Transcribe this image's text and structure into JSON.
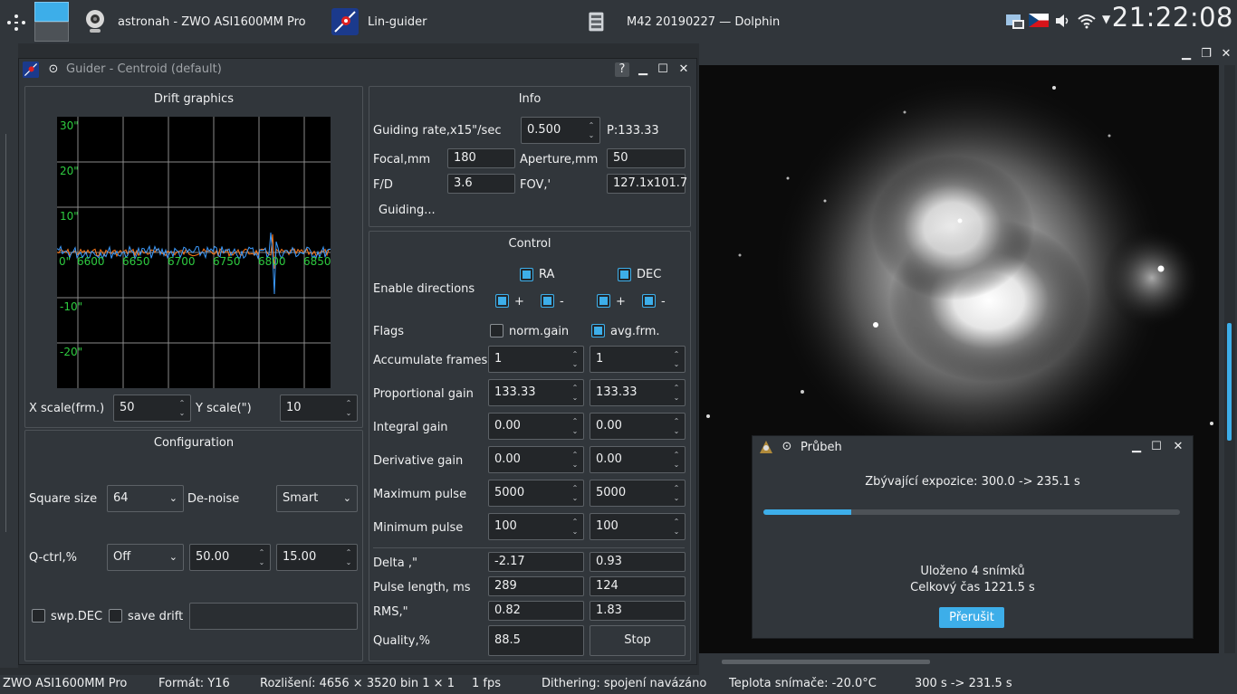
{
  "taskbar": {
    "tasks": [
      {
        "label": "astronah - ZWO ASI1600MM Pro",
        "icon": "webcam-icon"
      },
      {
        "label": "Lin-guider",
        "icon": "lin-guider-icon"
      },
      {
        "label": "M42 20190227 — Dolphin",
        "icon": "dolphin-icon"
      }
    ],
    "clock": "21:22:08"
  },
  "guider": {
    "title": "Guider - Centroid (default)",
    "drift": {
      "title": "Drift graphics",
      "y_labels": [
        "30\"",
        "20\"",
        "10\"",
        "-10\"",
        "-20\""
      ],
      "x_labels": [
        "0\"",
        "6600",
        "6650",
        "6700",
        "6750",
        "6800",
        "6850"
      ],
      "x_scale_label": "X scale(frm.)",
      "x_scale_value": "50",
      "y_scale_label": "Y scale(\")",
      "y_scale_value": "10"
    },
    "info": {
      "title": "Info",
      "guiding_rate_label": "Guiding rate,x15\"/sec",
      "guiding_rate_value": "0.500",
      "p_value": "P:133.33",
      "focal_label": "Focal,mm",
      "focal_value": "180",
      "aperture_label": "Aperture,mm",
      "aperture_value": "50",
      "fd_label": "F/D",
      "fd_value": "3.6",
      "fov_label": "FOV,'",
      "fov_value": "127.1x101.7",
      "status": "Guiding..."
    },
    "config": {
      "title": "Configuration",
      "square_size_label": "Square size",
      "square_size_value": "64",
      "denoise_label": "De-noise",
      "denoise_value": "Smart",
      "qctrl_label": "Q-ctrl,%",
      "qctrl_value": "Off",
      "qctrl_v1": "50.00",
      "qctrl_v2": "15.00",
      "swp_dec_label": "swp.DEC",
      "save_drift_label": "save drift",
      "save_drift_path": ""
    },
    "control": {
      "title": "Control",
      "enable_directions_label": "Enable directions",
      "ra_label": "RA",
      "dec_label": "DEC",
      "plus": "+",
      "minus": "-",
      "flags_label": "Flags",
      "norm_gain_label": "norm.gain",
      "avg_frm_label": "avg.frm.",
      "rows": [
        {
          "label": "Accumulate frames",
          "ra": "1",
          "dec": "1"
        },
        {
          "label": "Proportional gain",
          "ra": "133.33",
          "dec": "133.33"
        },
        {
          "label": "Integral gain",
          "ra": "0.00",
          "dec": "0.00"
        },
        {
          "label": "Derivative gain",
          "ra": "0.00",
          "dec": "0.00"
        },
        {
          "label": "Maximum pulse",
          "ra": "5000",
          "dec": "5000"
        },
        {
          "label": "Minimum pulse",
          "ra": "100",
          "dec": "100"
        }
      ],
      "delta_label": "Delta ,\"",
      "delta_ra": "-2.17",
      "delta_dec": "0.93",
      "pulse_label": "Pulse length, ms",
      "pulse_ra": "289",
      "pulse_dec": "124",
      "rms_label": "RMS,\"",
      "rms_ra": "0.82",
      "rms_dec": "1.83",
      "quality_label": "Quality,%",
      "quality_value": "88.5",
      "stop_label": "Stop"
    }
  },
  "progress": {
    "title": "Průbeh",
    "remaining": "Zbývající expozice: 300.0 -> 235.1 s",
    "progress_fraction": 0.21,
    "saved": "Uloženo 4 snímků",
    "total": "Celkový čas 1221.5 s",
    "abort_label": "Přerušit",
    "accent": "#3daee9"
  },
  "statusbar": {
    "camera": "ZWO ASI1600MM Pro",
    "format": "Formát: Y16",
    "resolution": "Rozlišení: 4656 × 3520 bin 1 × 1",
    "fps": "1 fps",
    "dithering": "Dithering: spojení navázáno",
    "temperature": "Teplota snímače: -20.0°C",
    "exposure": "300 s -> 231.5 s"
  }
}
